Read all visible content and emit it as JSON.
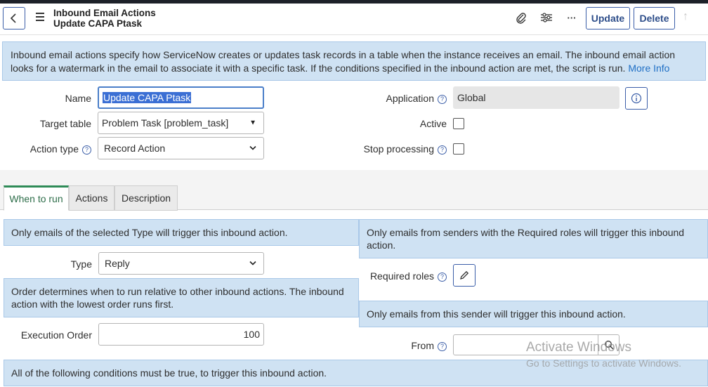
{
  "header": {
    "title_line1": "Inbound Email Actions",
    "title_line2": "Update CAPA Ptask",
    "update_label": "Update",
    "delete_label": "Delete",
    "more_label": "···"
  },
  "info_banner": {
    "text": "Inbound email actions specify how ServiceNow creates or updates task records in a table when the instance receives an email. The inbound email action looks for a watermark in the email to associate it with a specific task. If the conditions specified in the inbound action are met, the script is run. ",
    "link": "More Info"
  },
  "form": {
    "name_label": "Name",
    "name_value": "Update CAPA Ptask",
    "target_table_label": "Target table",
    "target_table_value": "Problem Task [problem_task]",
    "action_type_label": "Action type",
    "action_type_value": "Record Action",
    "application_label": "Application",
    "application_value": "Global",
    "active_label": "Active",
    "stop_processing_label": "Stop processing"
  },
  "tabs": [
    {
      "label": "When to run"
    },
    {
      "label": "Actions"
    },
    {
      "label": "Description"
    }
  ],
  "when_to_run": {
    "type_note": "Only emails of the selected Type will trigger this inbound action.",
    "type_label": "Type",
    "type_value": "Reply",
    "order_note": "Order determines when to run relative to other inbound actions. The inbound action with the lowest order runs first.",
    "execution_order_label": "Execution Order",
    "execution_order_value": "100",
    "conditions_note": "All of the following conditions must be true, to trigger this inbound action.",
    "roles_note": "Only emails from senders with the Required roles will trigger this inbound action.",
    "required_roles_label": "Required roles",
    "sender_note": "Only emails from this sender will trigger this inbound action.",
    "from_label": "From",
    "from_value": ""
  },
  "watermark": {
    "line1": "Activate Windows",
    "line2": "Go to Settings to activate Windows."
  }
}
